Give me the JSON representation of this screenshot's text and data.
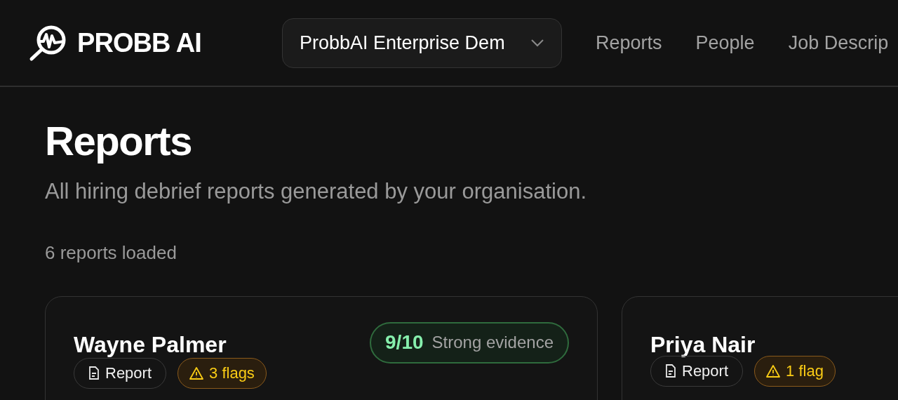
{
  "header": {
    "logo_text": "PROBB AI",
    "org_select": {
      "value": "ProbbAI Enterprise Dem"
    },
    "nav": [
      {
        "label": "Reports"
      },
      {
        "label": "People"
      },
      {
        "label": "Job Descrip"
      }
    ]
  },
  "page": {
    "title": "Reports",
    "subtitle": "All hiring debrief reports generated by your organisation.",
    "count": "6 reports loaded"
  },
  "cards": [
    {
      "name": "Wayne Palmer",
      "score": {
        "value": "9/10",
        "label": "Strong evidence",
        "color": "#86efac"
      },
      "badges": [
        {
          "kind": "report",
          "label": "Report"
        },
        {
          "kind": "flags",
          "label": "3 flags"
        }
      ]
    },
    {
      "name": "Priya Nair",
      "badges": [
        {
          "kind": "report",
          "label": "Report"
        },
        {
          "kind": "flags",
          "label": "1 flag"
        }
      ]
    }
  ]
}
